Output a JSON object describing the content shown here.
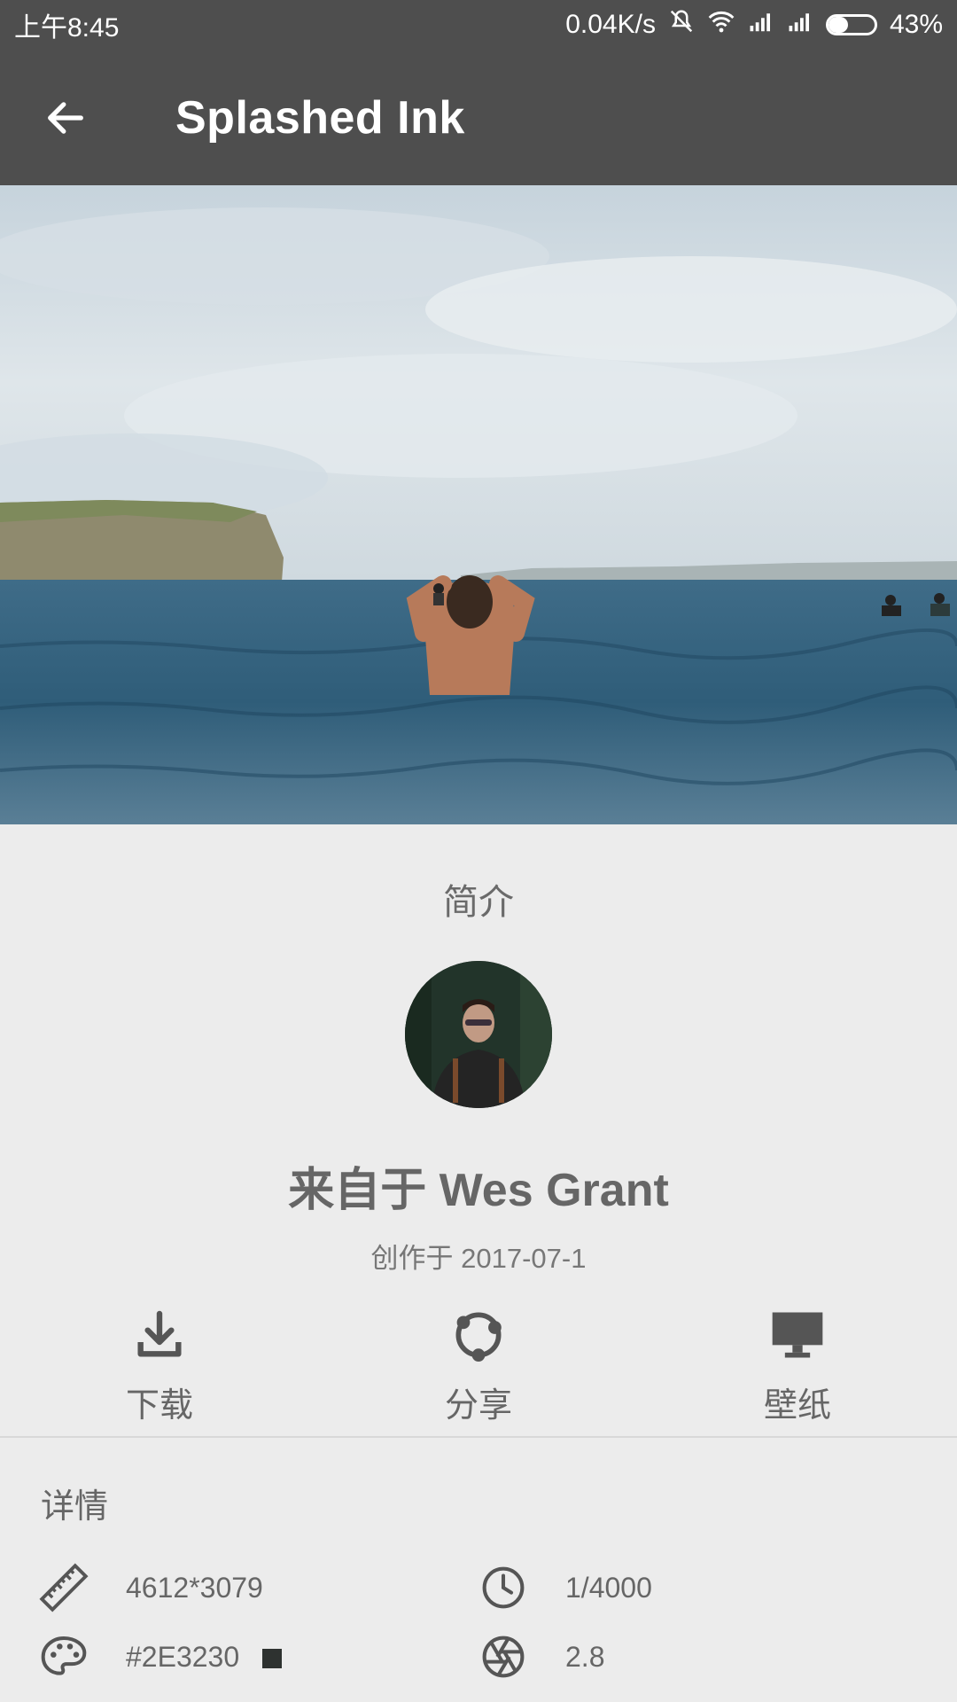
{
  "status_bar": {
    "time": "上午8:45",
    "speed": "0.04K/s",
    "battery": "43%",
    "battery_level": 0.43
  },
  "toolbar": {
    "title": "Splashed Ink",
    "back_icon": "arrow-left-icon"
  },
  "intro": {
    "title": "简介",
    "author": "来自于 Wes Grant",
    "created": "创作于 2017-07-1"
  },
  "actions": [
    {
      "label": "下载",
      "icon": "download-icon"
    },
    {
      "label": "分享",
      "icon": "share-icon"
    },
    {
      "label": "壁纸",
      "icon": "monitor-icon"
    }
  ],
  "details": {
    "title": "详情",
    "resolution": "4612*3079",
    "shutter": "1/4000",
    "color": "#2E3230",
    "color_swatch": "#2E3230",
    "aperture": "2.8"
  }
}
